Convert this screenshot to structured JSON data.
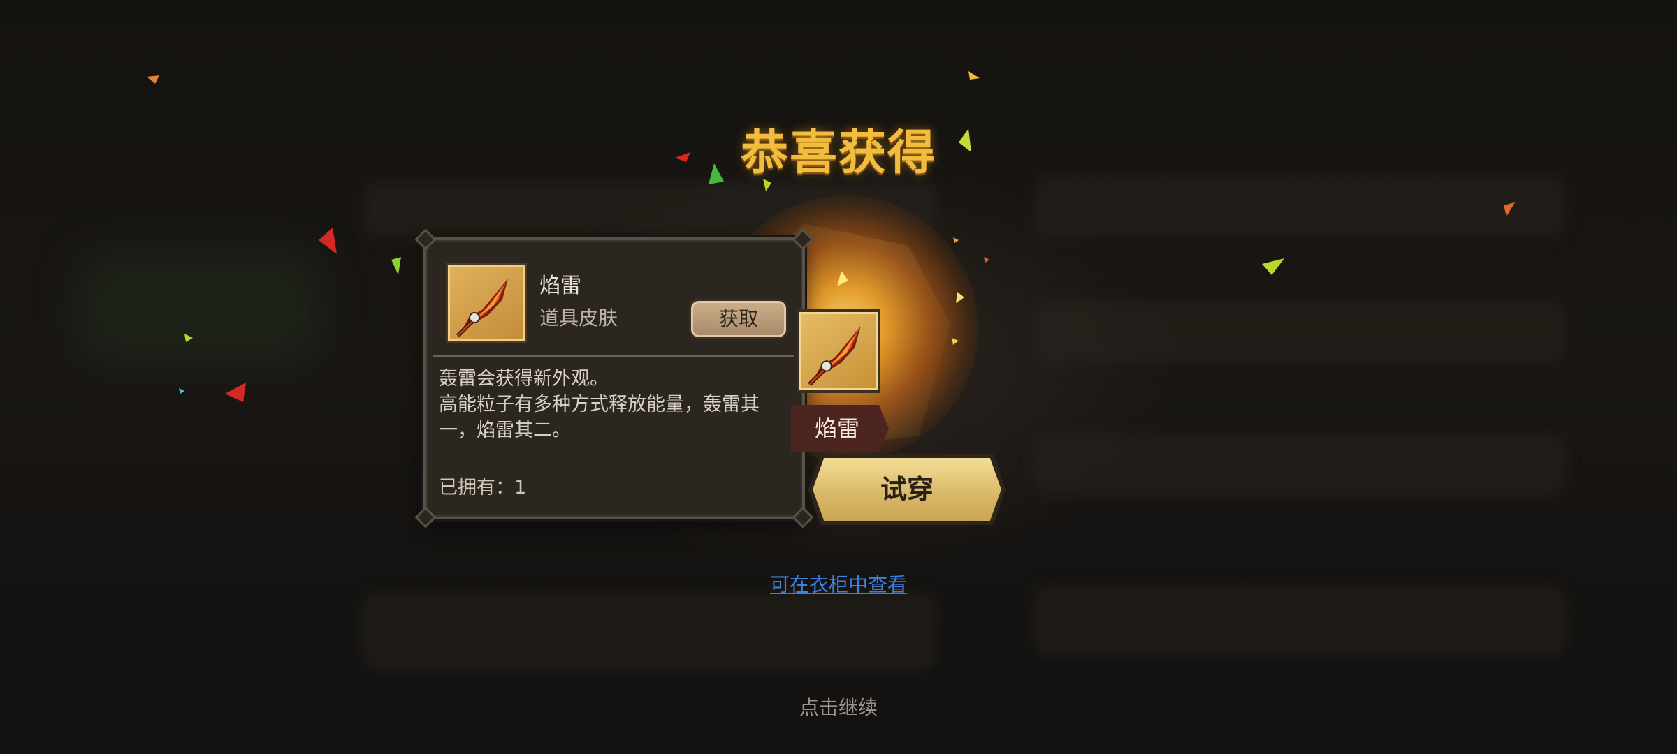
{
  "title": "恭喜获得",
  "item": {
    "name": "焰雷",
    "type": "道具皮肤",
    "obtain_label": "获取",
    "description": "轰雷会获得新外观。\n高能粒子有多种方式释放能量，轰雷其一，焰雷其二。",
    "owned_text": "已拥有：1",
    "icon": "flame-spear-icon"
  },
  "preview": {
    "name": "焰雷",
    "try_on_label": "试穿"
  },
  "wardrobe_link": "可在衣柜中查看",
  "tap_continue": "点击继续",
  "colors": {
    "title": "#f2bd3c",
    "link": "#3f7fe0",
    "button_gold": "#d8b867",
    "card_bg": "#2b2620",
    "banner": "#4c2420"
  }
}
